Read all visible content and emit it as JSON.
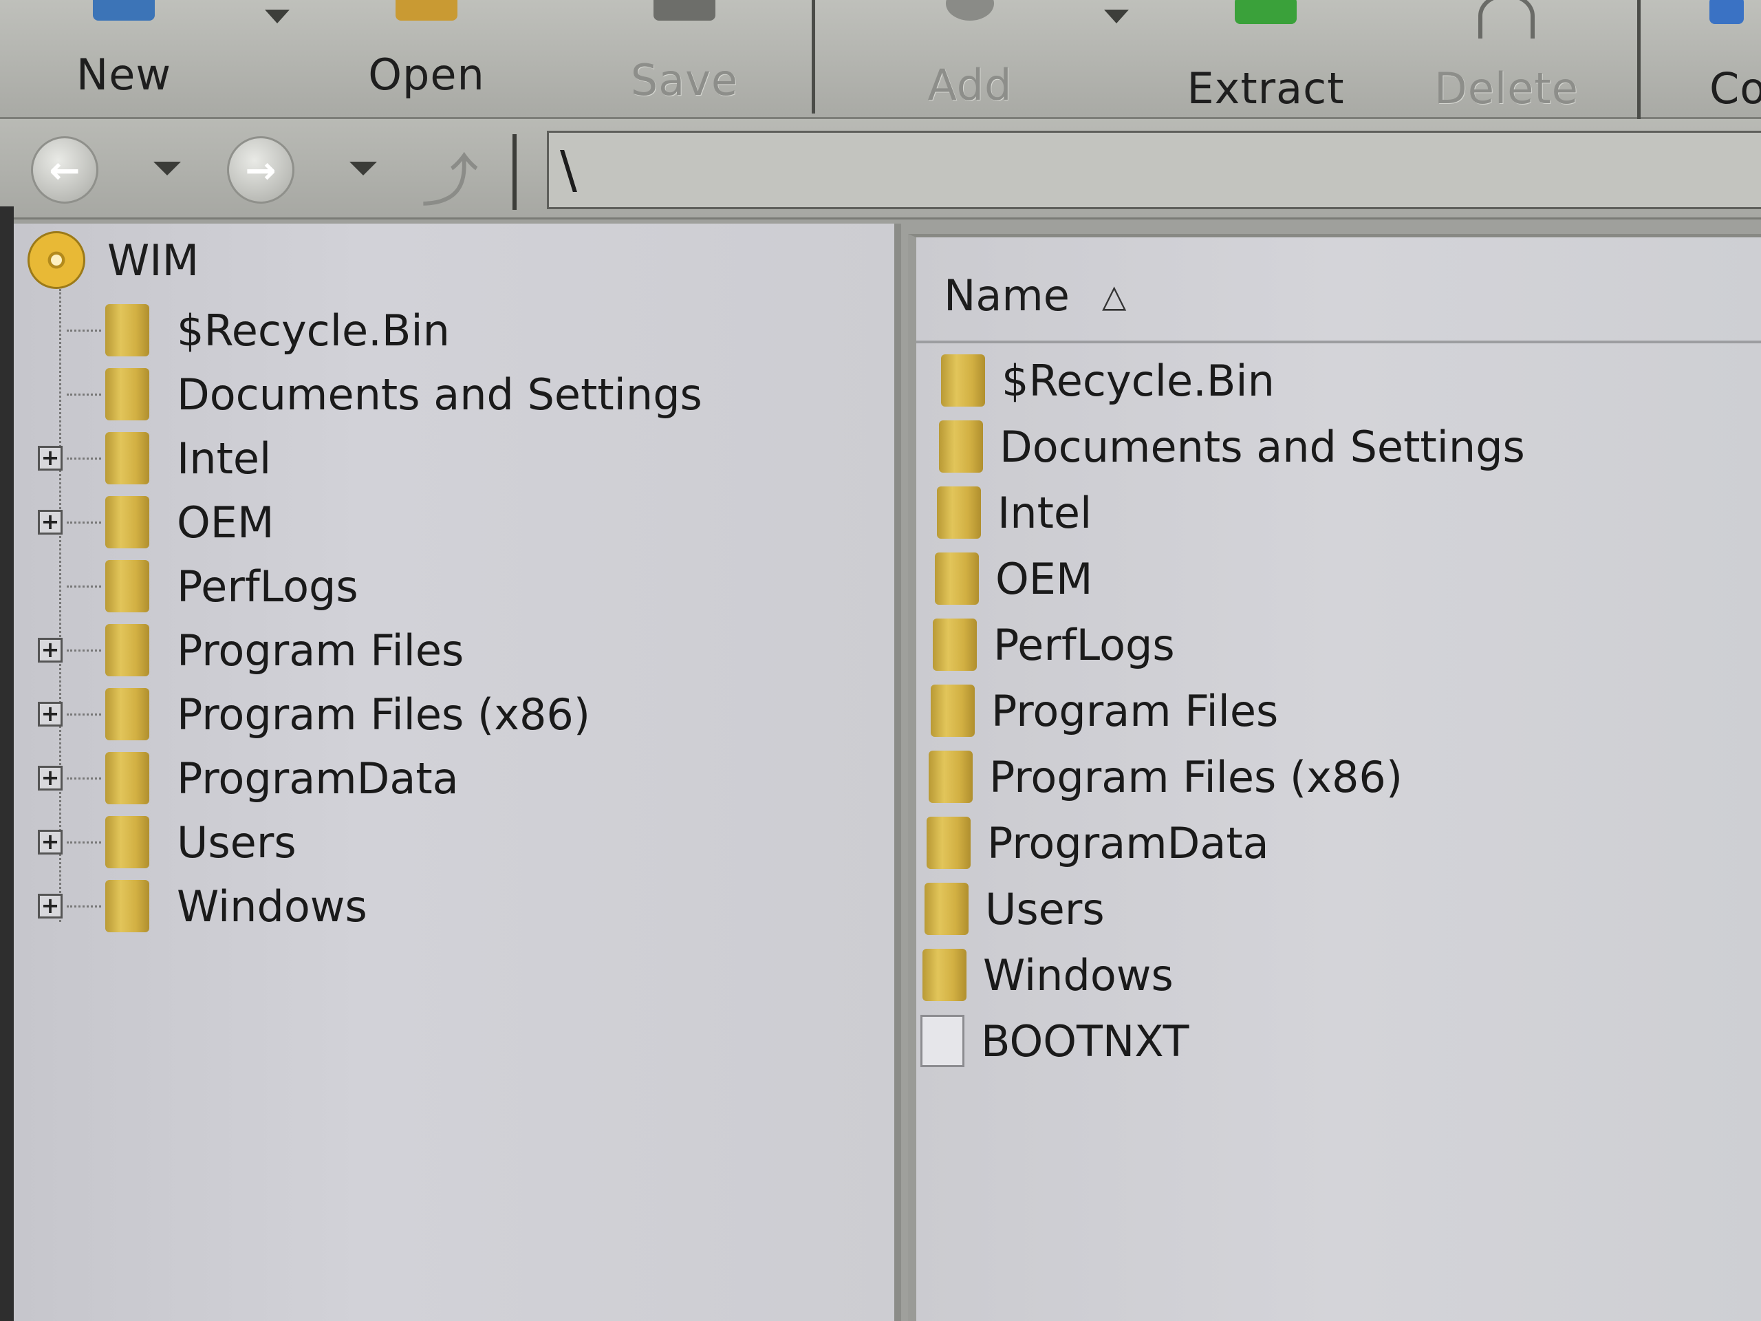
{
  "toolbar": {
    "new_label": "New",
    "open_label": "Open",
    "save_label": "Save",
    "add_label": "Add",
    "extract_label": "Extract",
    "delete_label": "Delete",
    "cut_label": "Co"
  },
  "address": {
    "path": "\\"
  },
  "tree": {
    "root": "WIM",
    "items": [
      {
        "label": "$Recycle.Bin",
        "expandable": false
      },
      {
        "label": "Documents and Settings",
        "expandable": false
      },
      {
        "label": "Intel",
        "expandable": true
      },
      {
        "label": "OEM",
        "expandable": true
      },
      {
        "label": "PerfLogs",
        "expandable": false
      },
      {
        "label": "Program Files",
        "expandable": true
      },
      {
        "label": "Program Files (x86)",
        "expandable": true
      },
      {
        "label": "ProgramData",
        "expandable": true
      },
      {
        "label": "Users",
        "expandable": true
      },
      {
        "label": "Windows",
        "expandable": true
      }
    ]
  },
  "list": {
    "column_name": "Name",
    "items": [
      {
        "label": "$Recycle.Bin",
        "type": "folder"
      },
      {
        "label": "Documents and Settings",
        "type": "folder"
      },
      {
        "label": "Intel",
        "type": "folder"
      },
      {
        "label": "OEM",
        "type": "folder"
      },
      {
        "label": "PerfLogs",
        "type": "folder"
      },
      {
        "label": "Program Files",
        "type": "folder"
      },
      {
        "label": "Program Files (x86)",
        "type": "folder"
      },
      {
        "label": "ProgramData",
        "type": "folder"
      },
      {
        "label": "Users",
        "type": "folder"
      },
      {
        "label": "Windows",
        "type": "folder"
      },
      {
        "label": "BOOTNXT",
        "type": "file"
      }
    ]
  },
  "colors": {
    "toolbar_bg": "#b4b5b0",
    "pane_bg": "#d0d0d6",
    "folder": "#d6b446"
  }
}
